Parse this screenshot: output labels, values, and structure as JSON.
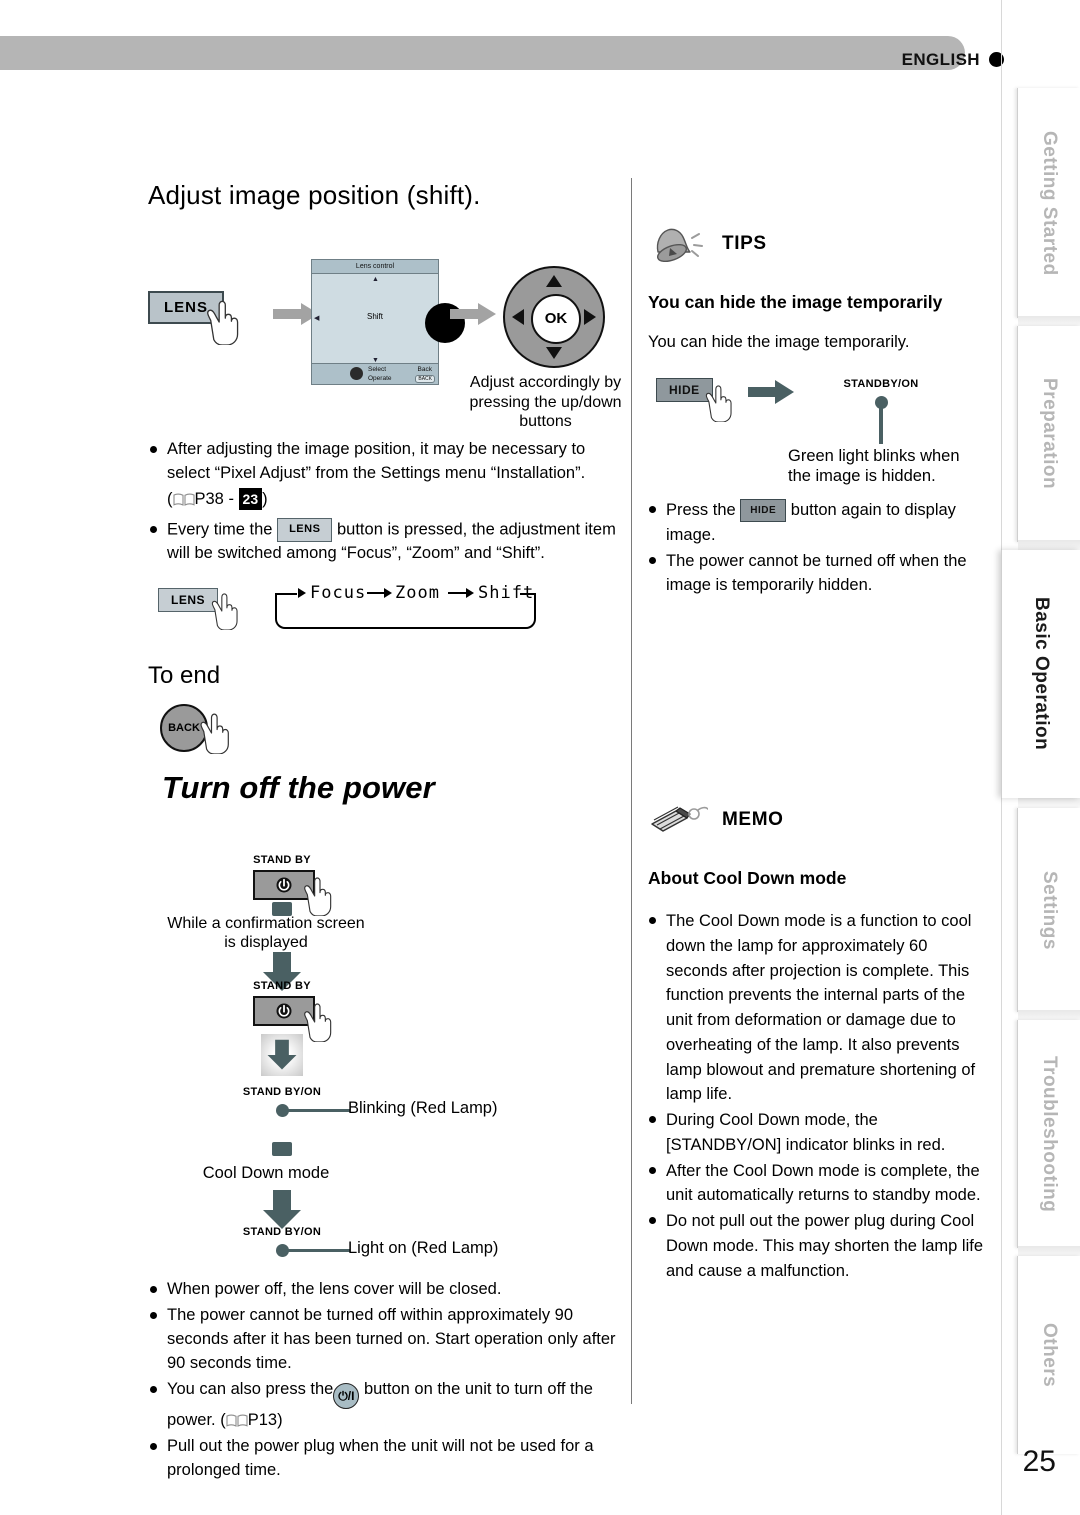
{
  "header": {
    "language": "ENGLISH",
    "dot_icon": "filled-circle-icon"
  },
  "left": {
    "section_title": "Adjust image position (shift).",
    "lens_button_label": "LENS",
    "osd": {
      "title": "Lens control",
      "center_label": "Shift",
      "select_label": "Select",
      "operate_label": "Operate",
      "back_label": "Back",
      "back_button_label": "BACK"
    },
    "pad": {
      "ok_label": "OK"
    },
    "pad_caption": "Adjust accordingly by pressing the up/down buttons",
    "bullets": [
      {
        "text_before": "After adjusting the image position, it may be necessary to select “Pixel Adjust” from the Settings menu “Installation”.",
        "ref_open": "(",
        "ref_page": "P38 - ",
        "ref_badge": "23",
        "ref_close": ")"
      },
      {
        "part1": "Every time the",
        "button": "LENS",
        "part2": "button is pressed, the adjustment item will be switched among “Focus”, “Zoom” and “Shift”."
      }
    ],
    "loop": {
      "lens_button_label": "LENS",
      "items": [
        "Focus",
        "Zoom",
        "Shift"
      ]
    },
    "to_end_title": "To end",
    "back_button_label": "BACK",
    "turn_off_title": "Turn off the power",
    "flow": {
      "standby_label": "STAND BY",
      "standby_on_label": "STAND BY/ON",
      "confirmation_text": "While a confirmation screen is displayed",
      "blinking_text": "Blinking (Red Lamp)",
      "cool_down_text": "Cool Down mode",
      "light_on_text": "Light on (Red Lamp)",
      "power_icon": "power-symbol-icon"
    },
    "notes": [
      "When power off, the lens cover will be closed.",
      "The power cannot be turned off within approximately 90 seconds after it has been turned on. Start operation only after 90 seconds time.",
      "Pull out the power plug when the unit will not be used for a prolonged time."
    ],
    "note_power": {
      "part1": "You can also press the",
      "glyph": "⏻/I",
      "part2": "button on the unit to turn off the power. (",
      "ref_page": "P13",
      "part3": ")"
    }
  },
  "right": {
    "tips": {
      "icon": "bell-icon",
      "title": "TIPS",
      "heading": "You can hide the image temporarily",
      "paragraph": "You can hide the image temporarily.",
      "hide_button_label": "HIDE",
      "standby_on_label": "STANDBY/ON",
      "indicator_caption": "Green light blinks when the image is hidden.",
      "bullets": [
        {
          "part1": "Press the",
          "button": "HIDE",
          "part2": "button again to display image."
        },
        {
          "part1": "The power cannot be turned off when the image is temporarily hidden.",
          "button": "",
          "part2": ""
        }
      ]
    },
    "memo": {
      "icon": "pencil-icon",
      "title": "MEMO",
      "heading": "About Cool Down mode",
      "bullets": [
        "The Cool Down mode is a function to cool down the lamp for approximately 60 seconds after projection is complete. This function prevents the internal parts of the unit from deformation or damage due to overheating of the lamp. It also prevents lamp blowout and premature shortening of lamp life.",
        "During Cool Down mode, the [STANDBY/ON] indicator blinks in red.",
        "After the Cool Down mode is complete, the unit automatically returns to standby mode.",
        "Do not pull out the power plug during Cool Down mode. This may shorten the lamp life and cause a malfunction."
      ]
    }
  },
  "tabs": [
    {
      "label": "Getting Started",
      "active": false
    },
    {
      "label": "Preparation",
      "active": false
    },
    {
      "label": "Basic Operation",
      "active": true
    },
    {
      "label": "Settings",
      "active": false
    },
    {
      "label": "Troubleshooting",
      "active": false
    },
    {
      "label": "Others",
      "active": false
    }
  ],
  "page_number": "25",
  "colors": {
    "accent": "#4a6063",
    "header_bar": "#b5b5b5",
    "button_face": "#9a9a9a",
    "lens_button": "#b9c3c9",
    "osd_bg": "#cfdce2"
  }
}
